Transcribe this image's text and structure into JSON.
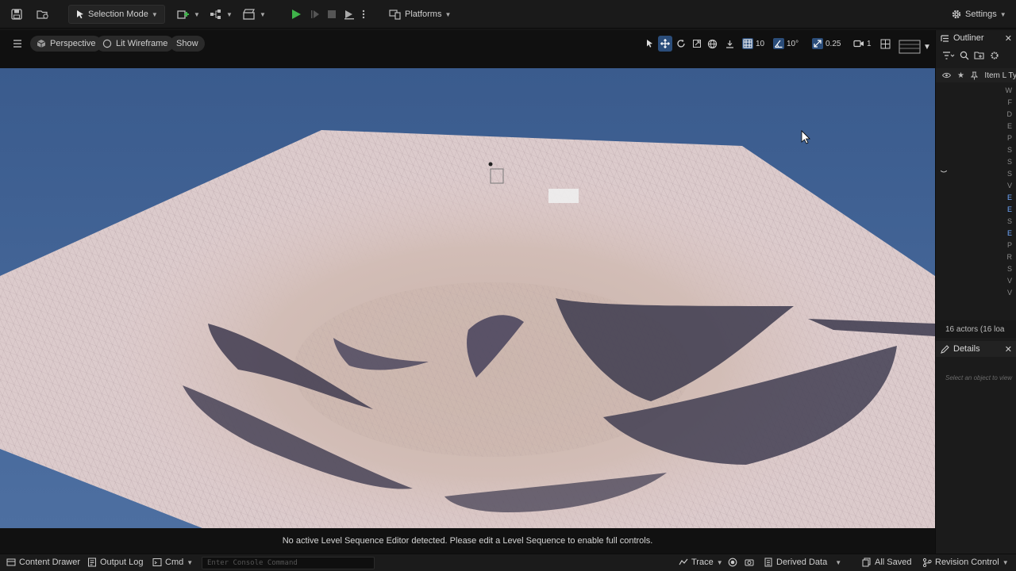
{
  "toolbar": {
    "selection_mode": "Selection Mode",
    "platforms": "Platforms",
    "settings": "Settings"
  },
  "viewport_bar": {
    "perspective": "Perspective",
    "view_mode": "Lit Wireframe",
    "show": "Show",
    "grid_snap": "10",
    "rotation_snap": "10°",
    "scale_snap": "0.25",
    "camera_speed": "1"
  },
  "outliner": {
    "title": "Outliner",
    "column_label": "Item L Ty",
    "actor_count": "16 actors (16 loa",
    "rows": [
      {
        "text": "W",
        "highlight": false
      },
      {
        "text": "F",
        "highlight": false
      },
      {
        "text": "D",
        "highlight": false
      },
      {
        "text": "E",
        "highlight": false
      },
      {
        "text": "P",
        "highlight": false
      },
      {
        "text": "S",
        "highlight": false
      },
      {
        "text": "S",
        "highlight": false
      },
      {
        "text": "S",
        "highlight": false
      },
      {
        "text": "V",
        "highlight": false
      },
      {
        "text": "E",
        "highlight": true
      },
      {
        "text": "E",
        "highlight": true
      },
      {
        "text": "S",
        "highlight": false
      },
      {
        "text": "E",
        "highlight": true
      },
      {
        "text": "P",
        "highlight": false
      },
      {
        "text": "R",
        "highlight": false
      },
      {
        "text": "S",
        "highlight": false
      },
      {
        "text": "V",
        "highlight": false
      },
      {
        "text": "V",
        "highlight": false
      }
    ]
  },
  "details": {
    "title": "Details",
    "empty_hint": "Select an object to view"
  },
  "sequence_message": "No active Level Sequence Editor detected. Please edit a Level Sequence to enable full controls.",
  "statusbar": {
    "content_drawer": "Content Drawer",
    "output_log": "Output Log",
    "cmd": "Cmd",
    "console_placeholder": "Enter Console Command",
    "trace": "Trace",
    "derived_data": "Derived Data",
    "all_saved": "All Saved",
    "revision_control": "Revision Control"
  },
  "colors": {
    "accent_blue": "#2b4d7a",
    "sky": "#3d5f8f",
    "terrain": "#d8c4c6",
    "play_green": "#3fb34a"
  }
}
